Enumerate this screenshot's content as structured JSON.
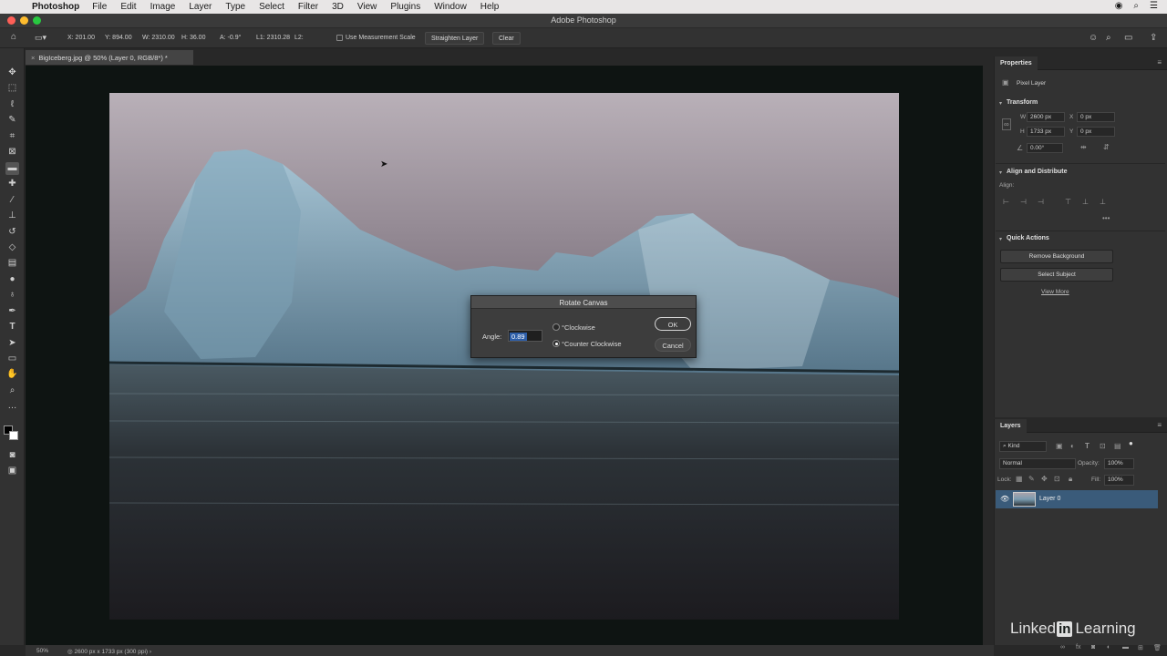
{
  "menubar": {
    "app_name": "Photoshop",
    "items": [
      "File",
      "Edit",
      "Image",
      "Layer",
      "Type",
      "Select",
      "Filter",
      "3D",
      "View",
      "Plugins",
      "Window",
      "Help"
    ]
  },
  "window": {
    "title": "Adobe Photoshop"
  },
  "options_bar": {
    "x": "X: 201.00",
    "y": "Y: 894.00",
    "w": "W: 2310.00",
    "h": "H: 36.00",
    "a": "A: -0.9°",
    "l1": "L1: 2310.28",
    "l2": "L2:",
    "measurement_scale_label": "Use Measurement Scale",
    "straighten_label": "Straighten Layer",
    "clear_label": "Clear"
  },
  "document_tab": {
    "title": "BigIceberg.jpg @ 50% (Layer 0, RGB/8*) *"
  },
  "dialog": {
    "title": "Rotate Canvas",
    "angle_label": "Angle:",
    "angle_value": "0.89",
    "option_cw": "°Clockwise",
    "option_ccw": "°Counter Clockwise",
    "selected": "ccw",
    "ok_label": "OK",
    "cancel_label": "Cancel"
  },
  "properties": {
    "tab": "Properties",
    "layer_kind": "Pixel Layer",
    "transform_label": "Transform",
    "w_label": "W",
    "w_value": "2600 px",
    "x_label": "X",
    "x_value": "0 px",
    "h_label": "H",
    "h_value": "1733 px",
    "y_label": "Y",
    "y_value": "0 px",
    "angle_value": "0.00°",
    "align_section": "Align and Distribute",
    "align_label": "Align:",
    "quick_actions": "Quick Actions",
    "remove_bg": "Remove Background",
    "select_subject": "Select Subject",
    "view_more": "View More"
  },
  "layers": {
    "tab": "Layers",
    "filter_kind": "Kind",
    "blend_mode": "Normal",
    "opacity_label": "Opacity:",
    "opacity_value": "100%",
    "lock_label": "Lock:",
    "fill_label": "Fill:",
    "fill_value": "100%",
    "items": [
      {
        "name": "Layer 0",
        "visible": true,
        "selected": true
      }
    ]
  },
  "status_bar": {
    "zoom": "50%",
    "doc_size": "2600 px x 1733 px (300 ppi)"
  },
  "watermark": {
    "pre": "Linked",
    "box": "in",
    "post": "Learning"
  },
  "colors": {
    "accent_selected_layer": "#3a5b7a",
    "dialog_bg": "#3d3d3d",
    "panel_bg": "#323232"
  }
}
